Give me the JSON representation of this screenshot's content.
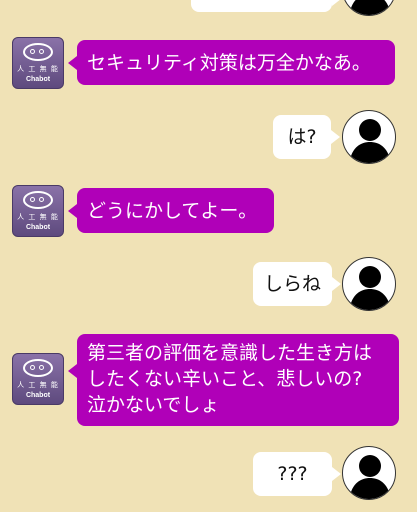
{
  "bot": {
    "logo_text_jp": "人 工 無 能",
    "logo_text_en": "Chabot"
  },
  "messages": [
    {
      "sender": "user",
      "text": ""
    },
    {
      "sender": "bot",
      "text": "セキュリティ対策は万全かなあ。"
    },
    {
      "sender": "user",
      "text": "は?"
    },
    {
      "sender": "bot",
      "text": "どうにかしてよー。"
    },
    {
      "sender": "user",
      "text": "しらね"
    },
    {
      "sender": "bot",
      "text": "第三者の評価を意識した生き方は\nしたくない辛いこと、悲しいの?\n泣かないでしょ"
    },
    {
      "sender": "user",
      "text": "???"
    }
  ],
  "colors": {
    "background": "#F0E2B6",
    "bot_bubble": "#B000B8",
    "user_bubble": "#FFFFFF",
    "bot_avatar": "#6E5A90"
  },
  "icons": {
    "user_avatar": "person-silhouette-icon",
    "bot_avatar": "chabot-logo-icon"
  }
}
